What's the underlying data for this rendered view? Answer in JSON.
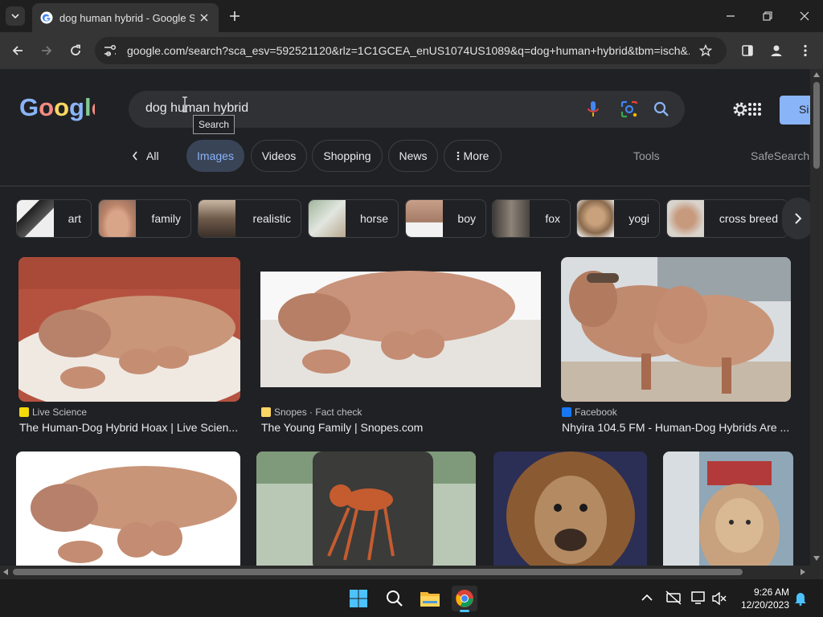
{
  "browser": {
    "tab_title": "dog human hybrid - Google Se",
    "url": "google.com/search?sca_esv=592521120&rlz=1C1GCEA_enUS1074US1089&q=dog+human+hybrid&tbm=isch&..."
  },
  "google": {
    "logo": "Google",
    "query": "dog human hybrid",
    "tooltip": "Search",
    "sign_in_label": "Si"
  },
  "filters": {
    "all": "All",
    "images": "Images",
    "videos": "Videos",
    "shopping": "Shopping",
    "news": "News",
    "more": "More",
    "tools": "Tools",
    "safesearch": "SafeSearch"
  },
  "related": [
    "art",
    "family",
    "realistic",
    "horse",
    "boy",
    "fox",
    "yogi",
    "cross breed"
  ],
  "results": [
    {
      "source": "Live Science",
      "title": "The Human-Dog Hybrid Hoax | Live Scien..."
    },
    {
      "source": "Snopes · Fact check",
      "title": "The Young Family | Snopes.com"
    },
    {
      "source": "Facebook",
      "title": "Nhyira 104.5 FM - Human-Dog Hybrids Are ..."
    }
  ],
  "taskbar": {
    "time": "9:26 AM",
    "date": "12/20/2023"
  },
  "colors": {
    "page_bg": "#202124",
    "accent": "#8ab4f8",
    "active_chip_bg": "#394457"
  }
}
